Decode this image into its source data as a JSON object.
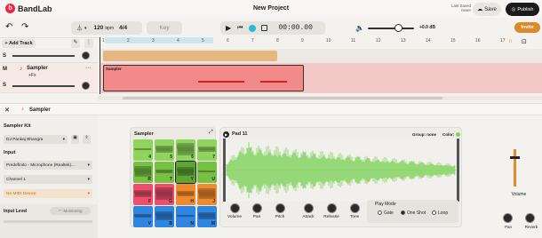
{
  "app": {
    "logo": "BandLab",
    "logo_mark": "b",
    "project_title": "New Project",
    "last_saved_label": "Last Saved",
    "last_saved_value": "never",
    "save_label": "Save",
    "publish_label": "Publish"
  },
  "transport": {
    "bpm": "120",
    "bpm_unit": "bpm",
    "signature": "4/4",
    "key_label": "Key",
    "time": "00:00.00",
    "volume_db": "+0.0 dB",
    "invite_label": "Invite"
  },
  "toolbar": {
    "add_track_label": "+ Add Track"
  },
  "ruler": {
    "bars": [
      "1",
      "2",
      "3",
      "4",
      "5",
      "6",
      "7",
      "8",
      "9",
      "10",
      "11",
      "12",
      "13",
      "14",
      "15",
      "16",
      "17"
    ]
  },
  "tracks": [
    {
      "solo": "S"
    },
    {
      "mute": "M",
      "solo": "S",
      "name": "Sampler",
      "fx": "+Fx"
    }
  ],
  "clips": {
    "sampler_clip_label": "Sampler"
  },
  "panel": {
    "title": "Sampler"
  },
  "left": {
    "kit_label": "Sampler Kit",
    "kit_value": "DJ Pankaj Bhangra",
    "input_label": "Input",
    "input_device": "Predefinito - Microphone (Realtek)...",
    "channel": "Channel 1",
    "midi": "No MIDI Device",
    "input_level_label": "Input Level",
    "monitoring_label": "Monitoring"
  },
  "sampler": {
    "title": "Sampler",
    "pads": [
      {
        "key": "4",
        "color": "#8fd45c"
      },
      {
        "key": "5",
        "color": "#8fd45c"
      },
      {
        "key": "6",
        "color": "#8fd45c"
      },
      {
        "key": "7",
        "color": "#8fd45c"
      },
      {
        "key": "R",
        "color": "#78c043"
      },
      {
        "key": "T",
        "color": "#78c043"
      },
      {
        "key": "Y",
        "color": "#5ea534"
      },
      {
        "key": "U",
        "color": "#78c043"
      },
      {
        "key": "F",
        "color": "#ec4f6c"
      },
      {
        "key": "G",
        "color": "#ec4f6c"
      },
      {
        "key": "H",
        "color": "#f08a2e"
      },
      {
        "key": "J",
        "color": "#f08a2e"
      },
      {
        "key": "V",
        "color": "#2f86e0"
      },
      {
        "key": "B",
        "color": "#2f86e0"
      },
      {
        "key": "N",
        "color": "#2f86e0"
      },
      {
        "key": "M",
        "color": "#2f86e0"
      }
    ]
  },
  "editor": {
    "pad_name": "Pad 11",
    "group_label": "Group: none",
    "color_label": "Color:",
    "controls": [
      "Volume",
      "Pan",
      "Pitch",
      "Attack",
      "Release",
      "Tone"
    ],
    "play_mode_label": "Play Mode",
    "modes": [
      "Gate",
      "One Shot",
      "Loop"
    ],
    "selected_mode": "One Shot"
  },
  "right": {
    "volume_label": "Volume",
    "pan_label": "Pan",
    "reverb_label": "Reverb"
  },
  "colors": {
    "accent_orange": "#d98a2b",
    "clip_red": "#f08a8a",
    "waveform": "#7ed35a",
    "track_orange": "#e6b77e"
  }
}
